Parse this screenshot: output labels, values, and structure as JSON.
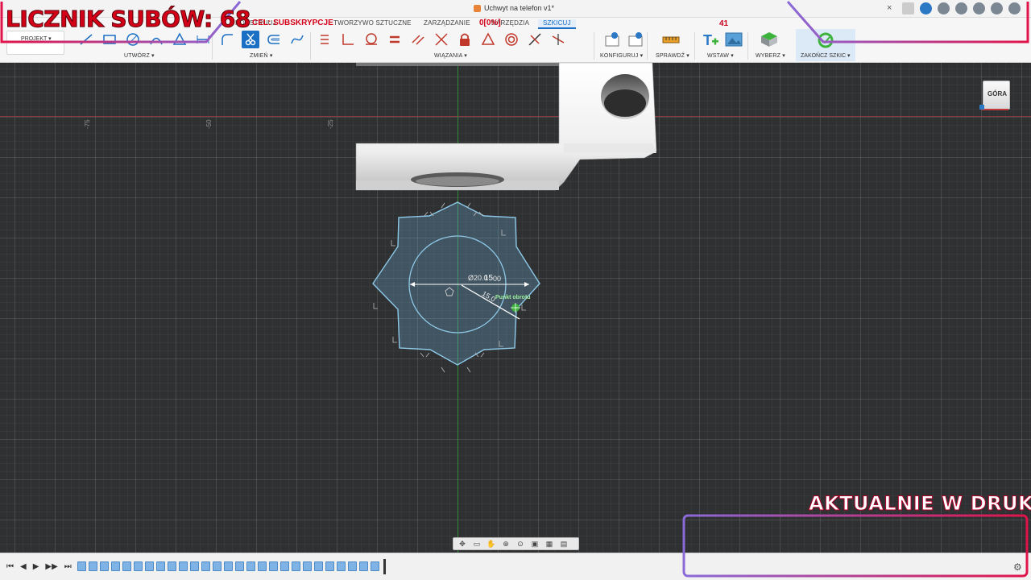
{
  "window": {
    "document_title": "Uchwyt na telefon v1*",
    "close_tab": "×"
  },
  "ribbon": {
    "tabs": [
      {
        "label": "KONSTRUUJ"
      },
      {
        "label": "TWORZYWO SZTUCZNE"
      },
      {
        "label": "ZARZĄDZANIE"
      },
      {
        "label": "NARZĘDZIA"
      },
      {
        "label": "SZKICUJ",
        "active": true
      }
    ],
    "project_label": "PROJEKT ▾",
    "groups": {
      "create": "UTWÓRZ ▾",
      "modify": "ZMIEŃ ▾",
      "constraints": "WIĄZANIA ▾",
      "configure": "KONFIGURUJ ▾",
      "inspect": "SPRAWDŹ ▾",
      "insert": "WSTAW ▾",
      "select": "WYBERZ ▾",
      "finish": "ZAKOŃCZ SZKIC ▾"
    },
    "goal_counter": "41"
  },
  "viewport": {
    "ruler_labels": [
      "-75",
      "-50",
      "-25"
    ],
    "viewcube_label": "GÓRA",
    "dimension_diameter": "Ø20.0",
    "dimension_15": "15",
    "dimension_00": "00",
    "dimension_radius": "15.0",
    "pivot_label": "Punkt obrotu"
  },
  "overlay": {
    "subscriber_counter": "LICZNIK SUBÓW: 68",
    "goal_label": "CEL: SUBSKRYPCJE",
    "goal_percent": "0[0%]",
    "now_printing": "AKTUALNIE W DRUKU"
  },
  "timeline": {
    "controls": [
      "⏮",
      "◀",
      "▶",
      "▶▶",
      "⏭"
    ],
    "item_count": 27
  },
  "colors": {
    "accent": "#1b6fc4",
    "overlay_red": "#d40017",
    "sketch_blue": "#8ec9e8",
    "finish_green": "#3cb43c"
  }
}
